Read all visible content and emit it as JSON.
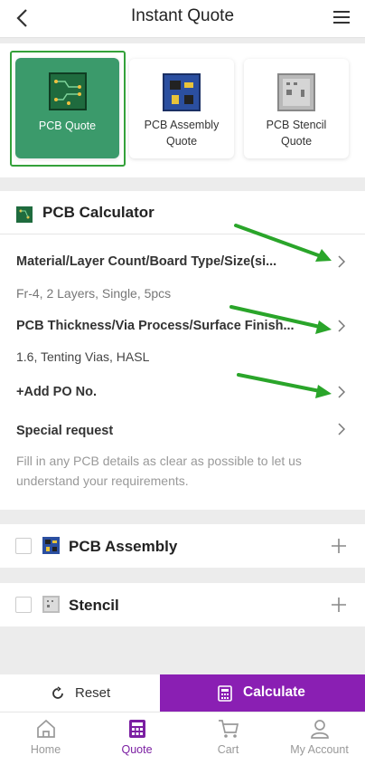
{
  "header": {
    "title": "Instant Quote"
  },
  "products": [
    {
      "label_line1": "PCB Quote",
      "label_line2": ""
    },
    {
      "label_line1": "PCB Assembly",
      "label_line2": "Quote"
    },
    {
      "label_line1": "PCB Stencil",
      "label_line2": "Quote"
    }
  ],
  "calculator": {
    "title": "PCB Calculator",
    "rows": [
      {
        "label": "Material/Layer Count/Board Type/Size(si...",
        "value": "Fr-4, 2 Layers, Single, 5pcs"
      },
      {
        "label": "PCB Thickness/Via Process/Surface Finish...",
        "value": "1.6, Tenting Vias, HASL"
      },
      {
        "label": "+Add PO No.",
        "value": ""
      },
      {
        "label": "Special request",
        "value": "Fill in any PCB details as clear as possible to let us understand your requirements."
      }
    ]
  },
  "sections": [
    {
      "title": "PCB Assembly"
    },
    {
      "title": "Stencil"
    }
  ],
  "actions": {
    "reset": "Reset",
    "calculate": "Calculate"
  },
  "tabs": [
    {
      "label": "Home",
      "icon": "home-icon"
    },
    {
      "label": "Quote",
      "icon": "calculator-icon"
    },
    {
      "label": "Cart",
      "icon": "cart-icon"
    },
    {
      "label": "My Account",
      "icon": "account-icon"
    }
  ],
  "colors": {
    "accent": "#8a1fb3",
    "active_card": "#3b9a6b",
    "annotation_arrow": "#2aa52a"
  }
}
